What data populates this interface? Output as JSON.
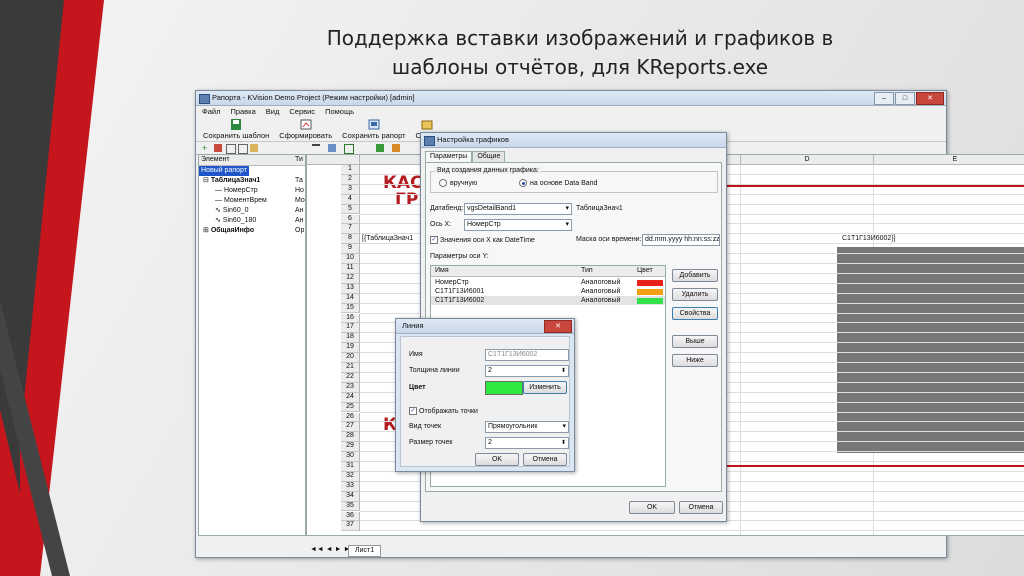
{
  "slide": {
    "title_line1": "Поддержка вставки изображений и графиков в",
    "title_line2": "шаблоны отчётов, для KReports.exe"
  },
  "main_window": {
    "title": "Рапорта - KVision Demo Project (Режим настройки) [admin]",
    "menu": [
      "Файл",
      "Правка",
      "Вид",
      "Сервис",
      "Помощь"
    ],
    "toolbar": {
      "save_template": "Сохранить шаблон",
      "generate": "Сформировать",
      "save_report": "Сохранить рапорт",
      "open": "Откры"
    },
    "tree_header": "Элемент",
    "tree_col2": "Ти",
    "tree": [
      {
        "label": "Новый рапорт",
        "selected": true
      },
      {
        "label": "ТаблицаЗнач1",
        "type": "Та"
      },
      {
        "label": "НомерСтр",
        "type": "Но"
      },
      {
        "label": "МоментВрем",
        "type": "Мо"
      },
      {
        "label": "Sin60_0",
        "type": "Ан"
      },
      {
        "label": "Sin60_180",
        "type": "Ан"
      },
      {
        "label": "ОбщаяИнфо",
        "type": "Ор"
      }
    ],
    "columns": [
      "A",
      "D",
      "E"
    ],
    "rows": [
      "1",
      "2",
      "3",
      "4",
      "5",
      "6",
      "7",
      "8",
      "9",
      "10",
      "11",
      "12",
      "13",
      "14",
      "15",
      "16",
      "17",
      "18",
      "19",
      "20",
      "21",
      "22",
      "23",
      "24",
      "25",
      "26",
      "27",
      "28",
      "29",
      "30",
      "31",
      "32",
      "33",
      "34",
      "35",
      "36",
      "37"
    ],
    "cell_a6": "[{ТаблицаЗнач1",
    "cell_d6": "С1Т1Г13И6002}]",
    "logo_text1": "КАС",
    "logo_text2": "ГР",
    "sheet_tab": "Лист1"
  },
  "graph_dialog": {
    "title": "Настройка графиков",
    "tabs": [
      "Параметры",
      "Общие"
    ],
    "group_title": "Вид создания данных графика:",
    "radio_manual": "вручную",
    "radio_databand": "на основе Data Band",
    "databand_label": "Датабенд:",
    "databand_value": "vgsDetailBand1",
    "databand_table": "ТаблицаЗнач1",
    "axis_x_label": "Ось X:",
    "axis_x_value": "НомерСтр",
    "datetime_check": "Значения оси X как DateTime",
    "mask_label": "Маска оси времени:",
    "mask_value": "dd.mm.yyyy hh:nn:ss:zz",
    "axis_y_label": "Параметры оси Y:",
    "table_headers": [
      "Имя",
      "Тип",
      "Цвет"
    ],
    "table_rows": [
      {
        "name": "НомерСтр",
        "type": "Аналоговый",
        "color": "#e8221a"
      },
      {
        "name": "С1Т1Г13И6001",
        "type": "Аналоговый",
        "color": "#f4a012"
      },
      {
        "name": "С1Т1Г13И6002",
        "type": "Аналоговый",
        "color": "#33e04a"
      }
    ],
    "btn_add": "Добавить",
    "btn_delete": "Удалить",
    "btn_props": "Свойства",
    "btn_up": "Выше",
    "btn_down": "Ниже",
    "btn_ok": "OK",
    "btn_cancel": "Отмена"
  },
  "line_dialog": {
    "title": "Линия",
    "name_label": "Имя",
    "name_value": "С1Т1Г13И6002",
    "thickness_label": "Толщина линии",
    "thickness_value": "2",
    "color_label": "Цвет",
    "color_value": "#2fe83f",
    "btn_change": "Изменить",
    "show_points": "Отображать точки",
    "point_type_label": "Вид точек",
    "point_type_value": "Прямоугольник",
    "point_size_label": "Размер точек",
    "point_size_value": "2",
    "btn_ok": "OK",
    "btn_cancel": "Отмена"
  }
}
